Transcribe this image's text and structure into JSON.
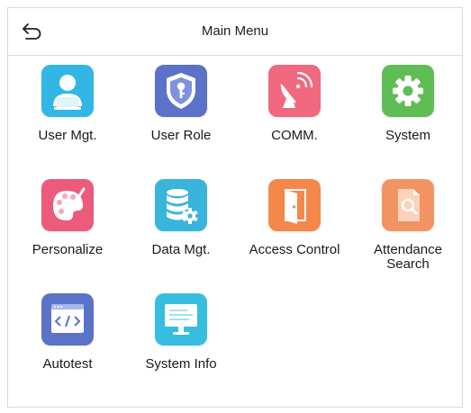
{
  "header": {
    "title": "Main Menu"
  },
  "colors": {
    "user": "#31b6e6",
    "role": "#5b72c9",
    "comm": "#f0697e",
    "system": "#5fbd55",
    "personalize": "#ec5b7c",
    "data": "#39b4da",
    "access": "#f4874a",
    "attendance": "#f29462",
    "autotest": "#5b72c9",
    "sysinfo": "#36bde0"
  },
  "menu": {
    "items": [
      {
        "label": "User Mgt.",
        "icon": "user-icon"
      },
      {
        "label": "User Role",
        "icon": "shield-key-icon"
      },
      {
        "label": "COMM.",
        "icon": "satellite-dish-icon"
      },
      {
        "label": "System",
        "icon": "gear-icon"
      },
      {
        "label": "Personalize",
        "icon": "palette-icon"
      },
      {
        "label": "Data Mgt.",
        "icon": "database-gear-icon"
      },
      {
        "label": "Access Control",
        "icon": "door-icon"
      },
      {
        "label": "Attendance\nSearch",
        "icon": "document-search-icon"
      },
      {
        "label": "Autotest",
        "icon": "code-window-icon"
      },
      {
        "label": "System Info",
        "icon": "monitor-icon"
      }
    ]
  }
}
